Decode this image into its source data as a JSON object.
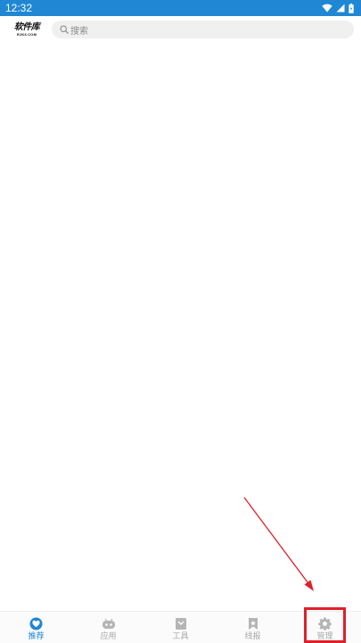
{
  "status_bar": {
    "time": "12:32",
    "icons": [
      "wifi-icon",
      "signal-icon",
      "battery-icon"
    ]
  },
  "header": {
    "logo": {
      "title": "软件库",
      "subtitle": "RJK6.COM"
    },
    "search": {
      "placeholder": "搜索",
      "icon": "search-icon"
    }
  },
  "tabs": [
    {
      "label": "推荐",
      "icon": "heart-icon",
      "active": true
    },
    {
      "label": "应用",
      "icon": "robot-icon",
      "active": false
    },
    {
      "label": "工具",
      "icon": "toolbox-icon",
      "active": false
    },
    {
      "label": "线报",
      "icon": "bookmark-icon",
      "active": false
    },
    {
      "label": "管理",
      "icon": "gear-icon",
      "active": false
    }
  ],
  "colors": {
    "accent": "#1f87d4",
    "inactive": "#a8a8a8",
    "annotation": "#e0202a"
  }
}
